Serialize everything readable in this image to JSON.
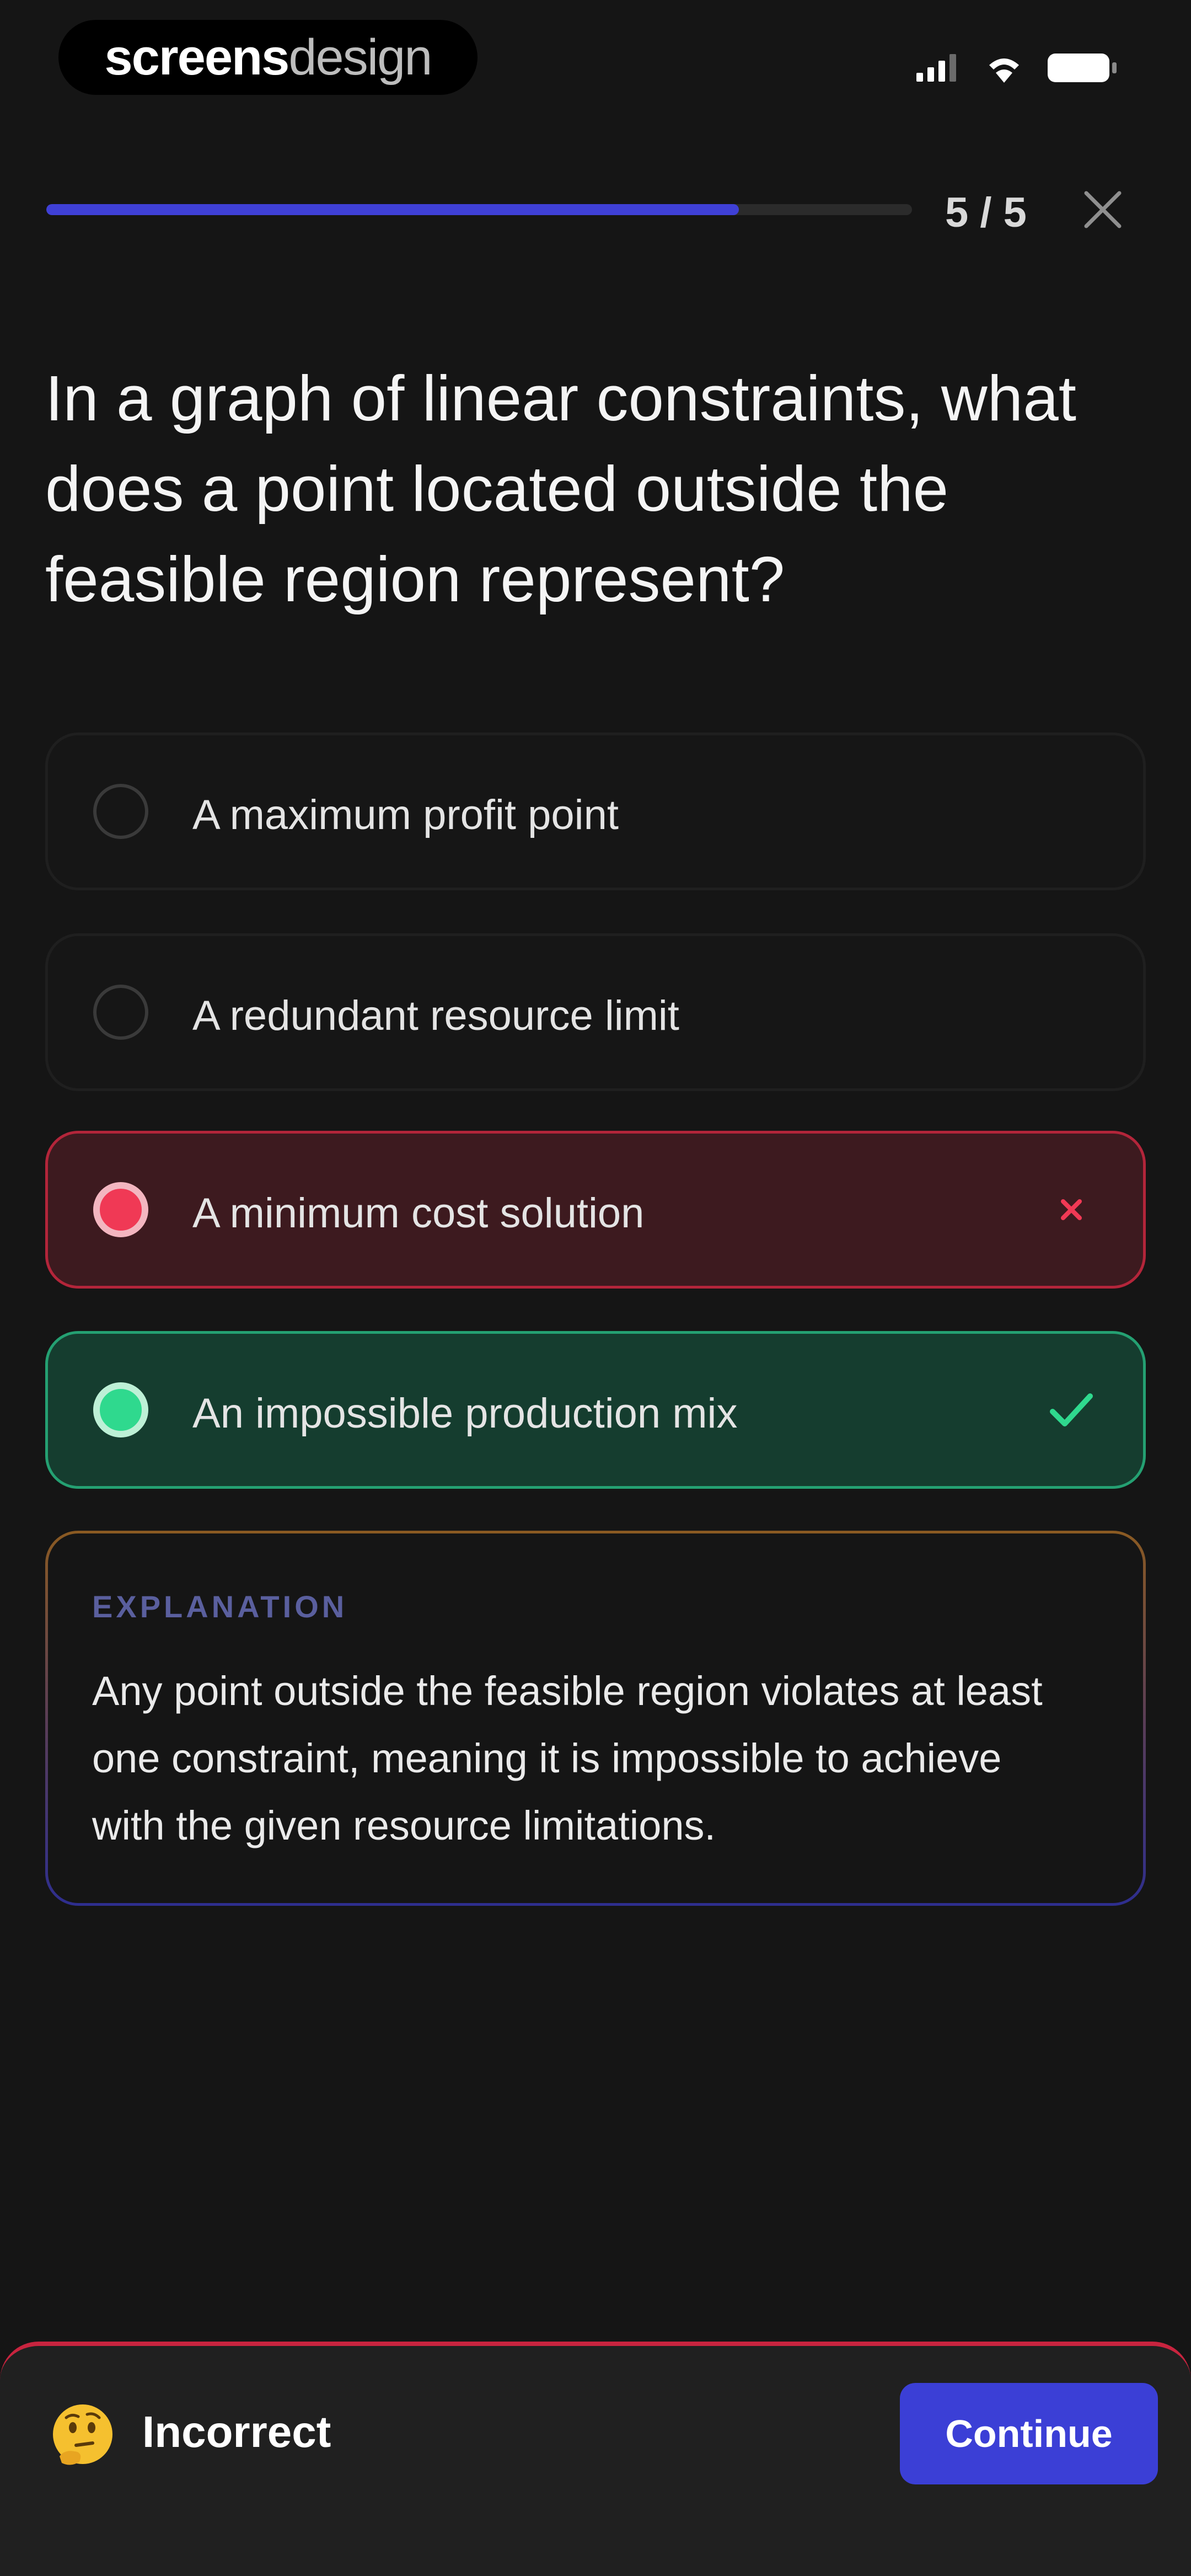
{
  "status_bar": {
    "brand_bold": "screens",
    "brand_light": "design",
    "icons": [
      "cellular-signal-icon",
      "wifi-icon",
      "battery-icon"
    ]
  },
  "progress": {
    "current": 5,
    "total": 5,
    "count_label": "5 / 5",
    "fill_fraction": 0.8,
    "fill_color": "#3f40d6"
  },
  "question": {
    "text": "In a graph of linear constraints, what does a point located outside the feasible region represent?"
  },
  "options": [
    {
      "label": "A maximum profit point",
      "state": "default"
    },
    {
      "label": "A redundant resource limit",
      "state": "default"
    },
    {
      "label": "A minimum cost solution",
      "state": "wrong",
      "mark_icon": "x-icon"
    },
    {
      "label": "An impossible production mix",
      "state": "correct",
      "mark_icon": "check-icon"
    }
  ],
  "explanation": {
    "title": "EXPLANATION",
    "text": "Any point outside the feasible region violates at least one constraint, meaning it is impossible to achieve with the given resource limitations."
  },
  "result": {
    "emoji_icon": "thinking-face-icon",
    "text": "Incorrect",
    "continue_label": "Continue"
  },
  "colors": {
    "accent": "#3b3fd6",
    "wrong": "#f03955",
    "correct": "#2fd98e",
    "background": "#151515"
  }
}
